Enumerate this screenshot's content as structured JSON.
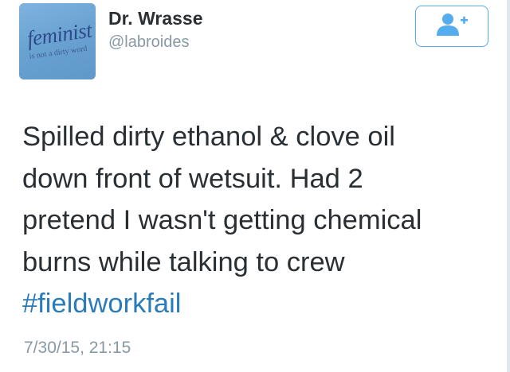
{
  "profile": {
    "display_name": "Dr. Wrasse",
    "handle": "@labroides",
    "avatar_text": "feminist",
    "avatar_subtext": "is not a dirty word"
  },
  "follow_button": {
    "icon": "follow-user-icon",
    "accent_color": "#55acee"
  },
  "tweet": {
    "lines": [
      "Spilled dirty ethanol & clove oil",
      "down front of wetsuit. Had 2",
      "pretend I wasn't getting chemical",
      "burns while talking to crew"
    ],
    "hashtag": "#fieldworkfail",
    "hashtag_color": "#2b7bb9",
    "timestamp": "7/30/15, 21:15"
  }
}
